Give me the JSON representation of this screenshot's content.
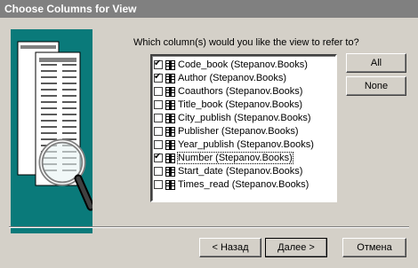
{
  "window": {
    "title": "Choose Columns for View"
  },
  "prompt": "Which column(s) would you like the view to refer to?",
  "columns": [
    {
      "label": "Code_book (Stepanov.Books)",
      "checked": true
    },
    {
      "label": "Author (Stepanov.Books)",
      "checked": true
    },
    {
      "label": "Coauthors (Stepanov.Books)",
      "checked": false
    },
    {
      "label": "Title_book (Stepanov.Books)",
      "checked": false
    },
    {
      "label": "City_publish (Stepanov.Books)",
      "checked": false
    },
    {
      "label": "Publisher (Stepanov.Books)",
      "checked": false
    },
    {
      "label": "Year_publish (Stepanov.Books)",
      "checked": false
    },
    {
      "label": "Number (Stepanov.Books)",
      "checked": true
    },
    {
      "label": "Start_date (Stepanov.Books)",
      "checked": false
    },
    {
      "label": "Times_read (Stepanov.Books)",
      "checked": false
    }
  ],
  "buttons": {
    "all": "All",
    "none": "None",
    "back": "< Назад",
    "next": "Далее >",
    "cancel": "Отмена"
  },
  "colors": {
    "teal": "#0a7a7a",
    "face": "#d4d0c8",
    "title": "#808080"
  }
}
